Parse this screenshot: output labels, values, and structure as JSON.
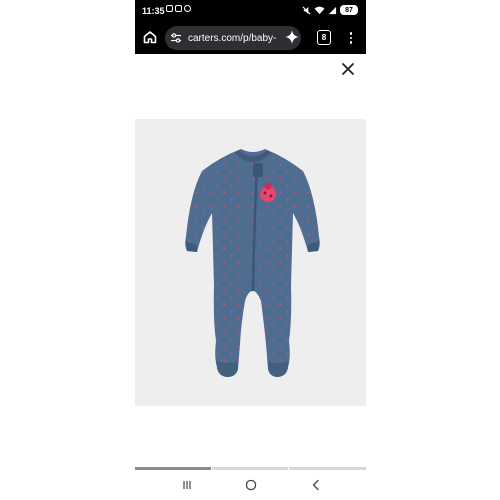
{
  "status_bar": {
    "time": "11:35",
    "battery": "87",
    "icons": [
      "notification-icon",
      "spotify-icon",
      "mute-icon",
      "wifi-icon",
      "signal-icon",
      "battery-icon"
    ]
  },
  "browser": {
    "url": "carters.com/p/baby-",
    "tab_count": "8",
    "toolbar_icons": [
      "home-icon",
      "site-settings-icon",
      "sparkle-icon",
      "tabs-icon",
      "more-vert-icon"
    ]
  },
  "viewer": {
    "close_icon": "close-icon",
    "product_image": "blue-footed-sleep-and-play-with-pink-ladybug-print",
    "gallery_position": {
      "current": 1,
      "total": 3
    }
  },
  "colors": {
    "background": "#ffffff",
    "browser_bar": "#000000",
    "url_pill": "#2f2f33",
    "image_bg": "#eeeeef",
    "garment": "#4e6d90",
    "print": "#e8456f",
    "progress_active": "#8a8a8a",
    "progress_inactive": "#d8d8d8"
  },
  "nav_bar": {
    "icons": [
      "recents-icon",
      "home-circle-icon",
      "back-icon"
    ]
  }
}
